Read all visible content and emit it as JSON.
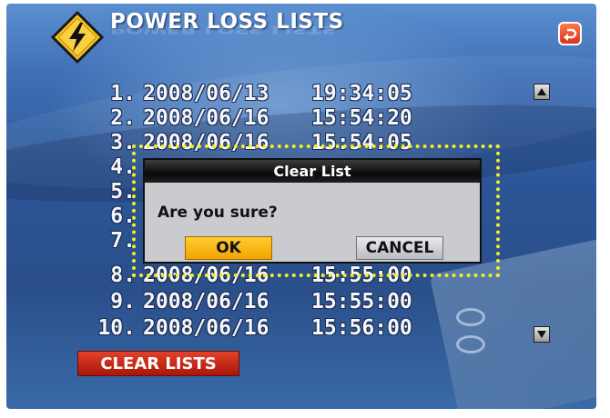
{
  "header": {
    "title": "POWER LOSS LISTS",
    "warning_icon": "lightning-warning-icon",
    "back_icon": "back-arrow-icon"
  },
  "list": {
    "rows": [
      {
        "index": "1.",
        "date": "2008/06/13",
        "time": "19:34:05"
      },
      {
        "index": "2.",
        "date": "2008/06/16",
        "time": "15:54:20"
      },
      {
        "index": "3.",
        "date": "2008/06/16",
        "time": "15:54:05"
      },
      {
        "index": "4.",
        "date": "",
        "time": ""
      },
      {
        "index": "5.",
        "date": "",
        "time": ""
      },
      {
        "index": "6.",
        "date": "",
        "time": ""
      },
      {
        "index": "7.",
        "date": "",
        "time": ""
      },
      {
        "index": "8.",
        "date": "2008/06/16",
        "time": "15:55:00"
      },
      {
        "index": "9.",
        "date": "2008/06/16",
        "time": "15:55:00"
      },
      {
        "index": "10.",
        "date": "2008/06/16",
        "time": "15:56:00"
      }
    ],
    "scroll_up_icon": "scroll-up-icon",
    "scroll_down_icon": "scroll-down-icon"
  },
  "clear_button": {
    "label": "CLEAR LISTS"
  },
  "dialog": {
    "title": "Clear List",
    "question": "Are you sure?",
    "ok_label": "OK",
    "cancel_label": "CANCEL"
  },
  "colors": {
    "highlight_dots": "#f2ee2a",
    "ok_button": "#f2a400",
    "clear_button": "#c8220e",
    "title_text": "#ffffff"
  }
}
